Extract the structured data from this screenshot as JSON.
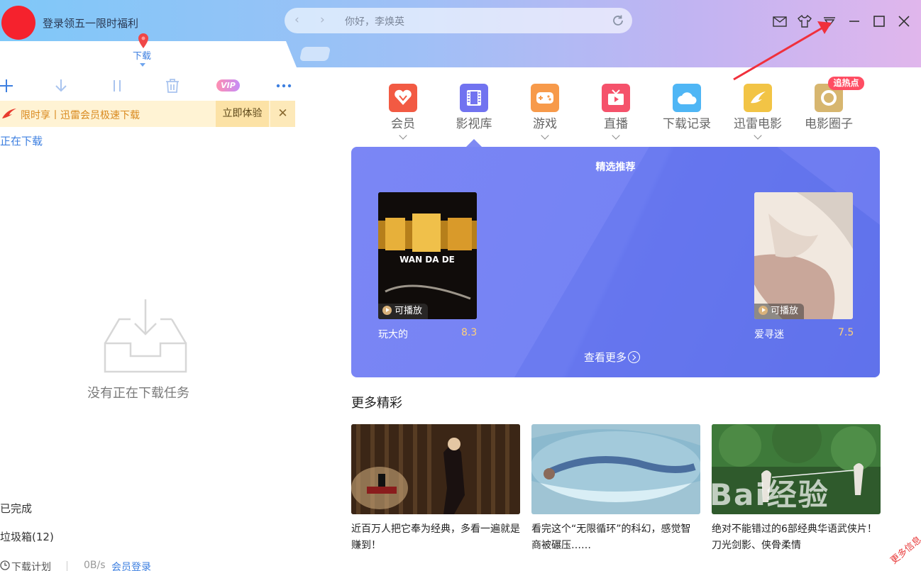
{
  "header": {
    "login_promo": "登录领五一限时福利",
    "address_greeting": "你好，李焕英"
  },
  "left_panel": {
    "tab_label": "下载",
    "promo_text": "限时享丨迅雷会员极速下载",
    "promo_try_label": "立即体验",
    "promo_close_label": "✕",
    "vip_badge": "VIP",
    "downloading_label": "正在下载",
    "empty_text": "没有正在下载任务",
    "completed_label": "已完成",
    "trash_label": "垃圾箱(12)",
    "status": {
      "plan_label": "下载计划",
      "speed": "0B/s",
      "vip_login": "会员登录"
    }
  },
  "nav": {
    "items": [
      {
        "label": "会员",
        "icon": "vip-heart-icon",
        "color": "#f25a43",
        "has_dropdown": true
      },
      {
        "label": "影视库",
        "icon": "film-icon",
        "color": "#7173f0",
        "has_dropdown": false
      },
      {
        "label": "游戏",
        "icon": "gamepad-icon",
        "color": "#f79a4a",
        "has_dropdown": true
      },
      {
        "label": "直播",
        "icon": "tv-icon",
        "color": "#f5526b",
        "has_dropdown": true
      },
      {
        "label": "下载记录",
        "icon": "cloud-icon",
        "color": "#4fb6f5",
        "has_dropdown": false
      },
      {
        "label": "迅雷电影",
        "icon": "bird-icon",
        "color": "#f2c445",
        "has_dropdown": true
      },
      {
        "label": "电影圈子",
        "icon": "circle-icon",
        "color": "#d7b66f",
        "has_dropdown": false
      }
    ],
    "hot_badge": "追热点"
  },
  "featured": {
    "title": "精选推荐",
    "movies": [
      {
        "title": "玩大的",
        "score": "8.3",
        "tag": "可播放",
        "poster_text": "WAN DA DE"
      },
      {
        "title": "爱寻迷",
        "score": "7.5",
        "tag": "可播放"
      }
    ],
    "see_more": "查看更多"
  },
  "more": {
    "title": "更多精彩",
    "cards": [
      {
        "caption": "近百万人把它奉为经典，多看一遍就是赚到！"
      },
      {
        "caption": "看完这个“无限循环”的科幻，感觉智商被碾压……"
      },
      {
        "caption": "绝对不能错过的6部经典华语武侠片！刀光剑影、侠骨柔情"
      }
    ]
  },
  "overlay": {
    "watermark": "Bai经验",
    "corner_stamp": "更多信息"
  },
  "colors": {
    "accent": "#3d7fe0",
    "promo_bg": "#fff3d4",
    "feature_bg": "#7583f4",
    "annotation_arrow": "#f0303c"
  }
}
